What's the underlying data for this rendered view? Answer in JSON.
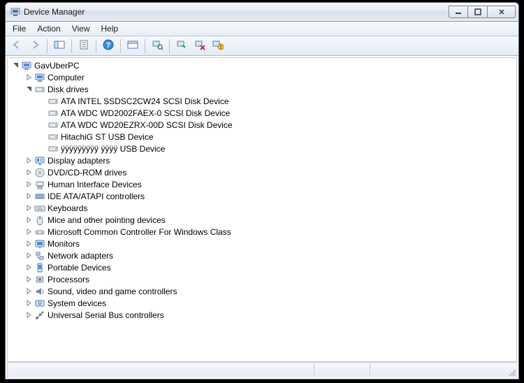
{
  "window": {
    "title": "Device Manager"
  },
  "menubar": {
    "items": [
      {
        "label": "File"
      },
      {
        "label": "Action"
      },
      {
        "label": "View"
      },
      {
        "label": "Help"
      }
    ]
  },
  "toolbar": {
    "items": [
      {
        "name": "back-button",
        "icon": "arrow-left",
        "disabled": true
      },
      {
        "name": "forward-button",
        "icon": "arrow-right",
        "disabled": true
      },
      {
        "sep": true
      },
      {
        "name": "show-hide-tree-button",
        "icon": "panel"
      },
      {
        "sep": true
      },
      {
        "name": "properties-button",
        "icon": "props"
      },
      {
        "sep": true
      },
      {
        "name": "help-button",
        "icon": "help"
      },
      {
        "sep": true
      },
      {
        "name": "action-button",
        "icon": "panel2"
      },
      {
        "sep": true
      },
      {
        "name": "scan-hardware-button",
        "icon": "scan"
      },
      {
        "sep": true
      },
      {
        "name": "update-driver-button",
        "icon": "update"
      },
      {
        "name": "uninstall-button",
        "icon": "uninstall"
      },
      {
        "name": "disable-button",
        "icon": "disable"
      }
    ]
  },
  "tree": {
    "root": {
      "label": "GavUberPC",
      "icon": "computer-root",
      "expanded": true,
      "children": [
        {
          "label": "Computer",
          "icon": "computer",
          "expandable": true
        },
        {
          "label": "Disk drives",
          "icon": "disk",
          "expandable": true,
          "expanded": true,
          "children": [
            {
              "label": "ATA INTEL SSDSC2CW24 SCSI Disk Device",
              "icon": "disk"
            },
            {
              "label": "ATA WDC WD2002FAEX-0 SCSI Disk Device",
              "icon": "disk"
            },
            {
              "label": "ATA WDC WD20EZRX-00D SCSI Disk Device",
              "icon": "disk"
            },
            {
              "label": "HitachiG ST USB Device",
              "icon": "disk"
            },
            {
              "label": "ÿÿÿÿÿÿÿÿÿ ÿÿÿÿ USB Device",
              "icon": "disk"
            }
          ]
        },
        {
          "label": "Display adapters",
          "icon": "display",
          "expandable": true
        },
        {
          "label": "DVD/CD-ROM drives",
          "icon": "dvd",
          "expandable": true
        },
        {
          "label": "Human Interface Devices",
          "icon": "hid",
          "expandable": true
        },
        {
          "label": "IDE ATA/ATAPI controllers",
          "icon": "ide",
          "expandable": true
        },
        {
          "label": "Keyboards",
          "icon": "keyboard",
          "expandable": true
        },
        {
          "label": "Mice and other pointing devices",
          "icon": "mouse",
          "expandable": true
        },
        {
          "label": "Microsoft Common Controller For Windows Class",
          "icon": "controller",
          "expandable": true
        },
        {
          "label": "Monitors",
          "icon": "monitor",
          "expandable": true
        },
        {
          "label": "Network adapters",
          "icon": "network",
          "expandable": true
        },
        {
          "label": "Portable Devices",
          "icon": "portable",
          "expandable": true
        },
        {
          "label": "Processors",
          "icon": "cpu",
          "expandable": true
        },
        {
          "label": "Sound, video and game controllers",
          "icon": "sound",
          "expandable": true
        },
        {
          "label": "System devices",
          "icon": "system",
          "expandable": true
        },
        {
          "label": "Universal Serial Bus controllers",
          "icon": "usb",
          "expandable": true
        }
      ]
    }
  },
  "colors": {
    "titlebar_grad_top": "#f6f8fb",
    "titlebar_grad_bot": "#e6ecf5",
    "menu_bg": "#e8eef7",
    "border": "#6a6a6a"
  }
}
